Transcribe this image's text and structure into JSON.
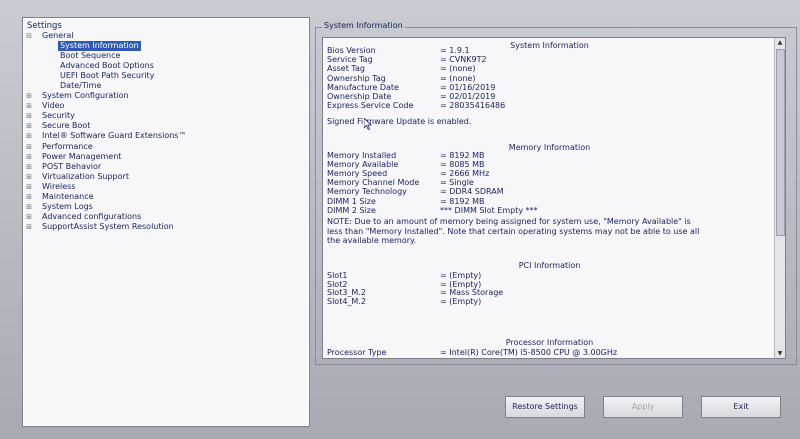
{
  "tree": {
    "root": "Settings",
    "items": [
      {
        "label": "General",
        "level": 0,
        "expander": "⊟"
      },
      {
        "label": "System Information",
        "level": 1,
        "selected": true
      },
      {
        "label": "Boot Sequence",
        "level": 1
      },
      {
        "label": "Advanced Boot Options",
        "level": 1
      },
      {
        "label": "UEFI Boot Path Security",
        "level": 1
      },
      {
        "label": "Date/Time",
        "level": 1
      },
      {
        "label": "System Configuration",
        "level": 0,
        "expander": "⊞"
      },
      {
        "label": "Video",
        "level": 0,
        "expander": "⊞"
      },
      {
        "label": "Security",
        "level": 0,
        "expander": "⊞"
      },
      {
        "label": "Secure Boot",
        "level": 0,
        "expander": "⊞"
      },
      {
        "label": "Intel® Software Guard Extensions™",
        "level": 0,
        "expander": "⊞"
      },
      {
        "label": "Performance",
        "level": 0,
        "expander": "⊞"
      },
      {
        "label": "Power Management",
        "level": 0,
        "expander": "⊞"
      },
      {
        "label": "POST Behavior",
        "level": 0,
        "expander": "⊞"
      },
      {
        "label": "Virtualization Support",
        "level": 0,
        "expander": "⊞"
      },
      {
        "label": "Wireless",
        "level": 0,
        "expander": "⊞"
      },
      {
        "label": "Maintenance",
        "level": 0,
        "expander": "⊞"
      },
      {
        "label": "System Logs",
        "level": 0,
        "expander": "⊞"
      },
      {
        "label": "Advanced configurations",
        "level": 0,
        "expander": "⊞"
      },
      {
        "label": "SupportAssist System Resolution",
        "level": 0,
        "expander": "⊞"
      }
    ]
  },
  "info": {
    "frame_title": "System Information",
    "system": {
      "title": "System Information",
      "rows": [
        {
          "k": "Bios Version",
          "v": "= 1.9.1"
        },
        {
          "k": "Service Tag",
          "v": "= CVNK9T2"
        },
        {
          "k": "Asset Tag",
          "v": "= (none)"
        },
        {
          "k": "Ownership Tag",
          "v": "= (none)"
        },
        {
          "k": "Manufacture Date",
          "v": "= 01/16/2019"
        },
        {
          "k": "Ownership Date",
          "v": "= 02/01/2019"
        },
        {
          "k": "Express Service Code",
          "v": "= 28035416486"
        }
      ],
      "firmware_note": "Signed Firmware Update is enabled."
    },
    "memory": {
      "title": "Memory Information",
      "rows": [
        {
          "k": "Memory Installed",
          "v": "= 8192 MB"
        },
        {
          "k": "Memory Available",
          "v": "= 8085 MB"
        },
        {
          "k": "Memory Speed",
          "v": "= 2666 MHz"
        },
        {
          "k": "Memory Channel Mode",
          "v": "= Single"
        },
        {
          "k": "Memory Technology",
          "v": "= DDR4 SDRAM"
        },
        {
          "k": "DIMM 1 Size",
          "v": "= 8192 MB"
        },
        {
          "k": "DIMM 2 Size",
          "v": "*** DIMM Slot Empty ***"
        }
      ],
      "note": "NOTE: Due to an amount of memory being assigned for system use, \"Memory Available\" is less than \"Memory Installed\". Note that certain operating systems may not be able to use all the available memory."
    },
    "pci": {
      "title": "PCI Information",
      "rows": [
        {
          "k": "Slot1",
          "v": "= (Empty)"
        },
        {
          "k": "Slot2",
          "v": "= (Empty)"
        },
        {
          "k": "Slot3_M.2",
          "v": "= Mass Storage"
        },
        {
          "k": "Slot4_M.2",
          "v": "= (Empty)"
        }
      ]
    },
    "processor": {
      "title": "Processor Information",
      "rows": [
        {
          "k": "Processor Type",
          "v": "= Intel(R) Core(TM) i5-8500 CPU @ 3.00GHz"
        }
      ]
    }
  },
  "buttons": {
    "restore": "Restore Settings",
    "apply": "Apply",
    "exit": "Exit"
  },
  "icons": {
    "scroll_up": "scroll-up-arrow-icon",
    "scroll_down": "scroll-down-arrow-icon",
    "cursor": "mouse-pointer-icon"
  }
}
